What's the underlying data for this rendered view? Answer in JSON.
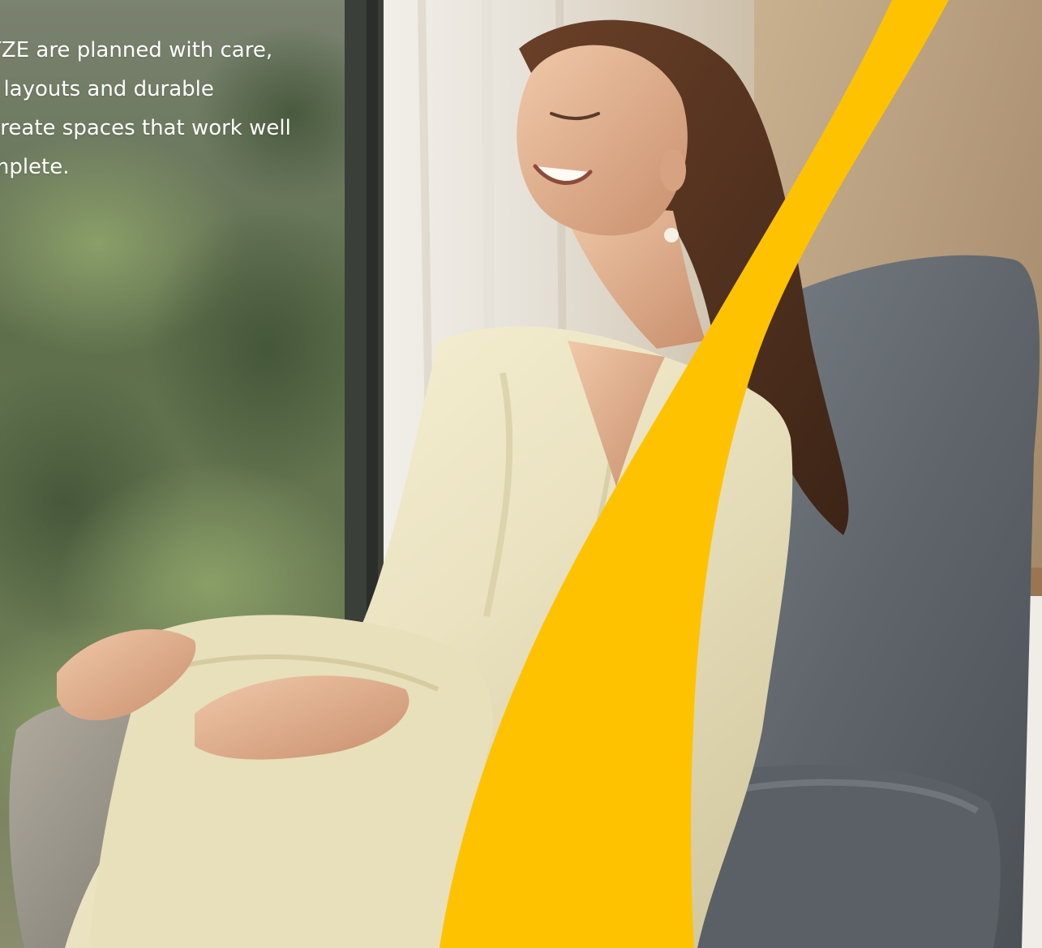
{
  "hero": {
    "text_lines": [
      "YZE are planned with care,",
      "t layouts and durable",
      "create spaces that work well",
      "mplete."
    ],
    "image": {
      "subject": "woman-relaxing-in-armchair",
      "colors": {
        "accent_swoosh": "#ffc200",
        "chair": "#6b7178",
        "robe": "#e9e1c2",
        "window_foliage": "#5c6f4a",
        "curtain": "#d9d2c6",
        "wall": "#b79b7a"
      }
    }
  }
}
